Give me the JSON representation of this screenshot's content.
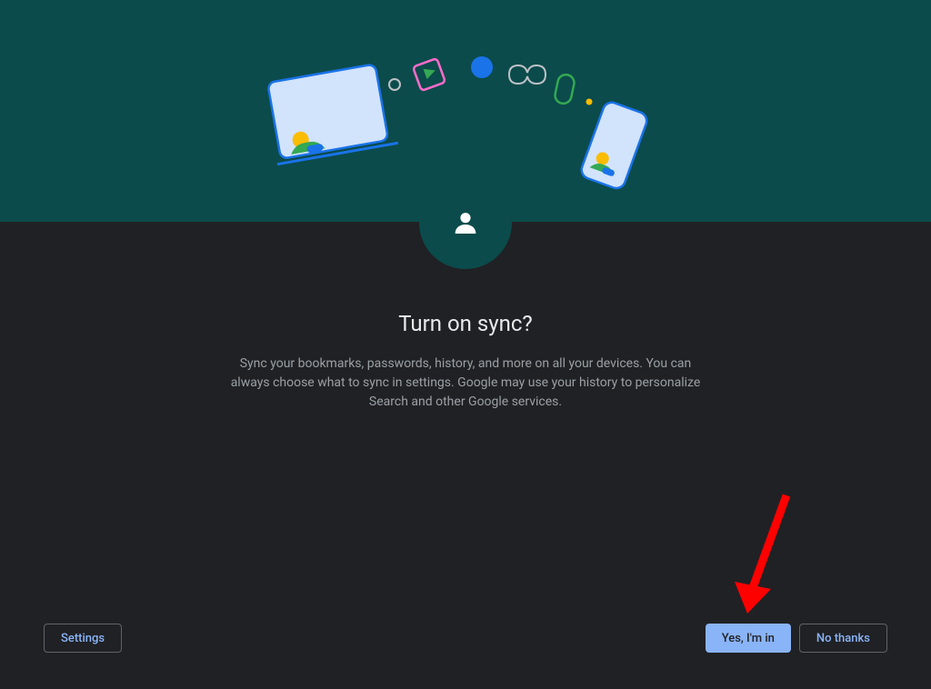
{
  "heading": "Turn on sync?",
  "description": "Sync your bookmarks, passwords, history, and more on all your devices. You can always choose what to sync in settings. Google may use your history to personalize Search and other Google services.",
  "buttons": {
    "settings": "Settings",
    "confirm": "Yes, I'm in",
    "decline": "No thanks"
  },
  "colors": {
    "banner": "#0b4b4b",
    "background": "#202124",
    "primaryButton": "#8ab4f8",
    "textPrimary": "#e8eaed",
    "textSecondary": "#9aa0a6",
    "arrow": "#ff0000"
  }
}
